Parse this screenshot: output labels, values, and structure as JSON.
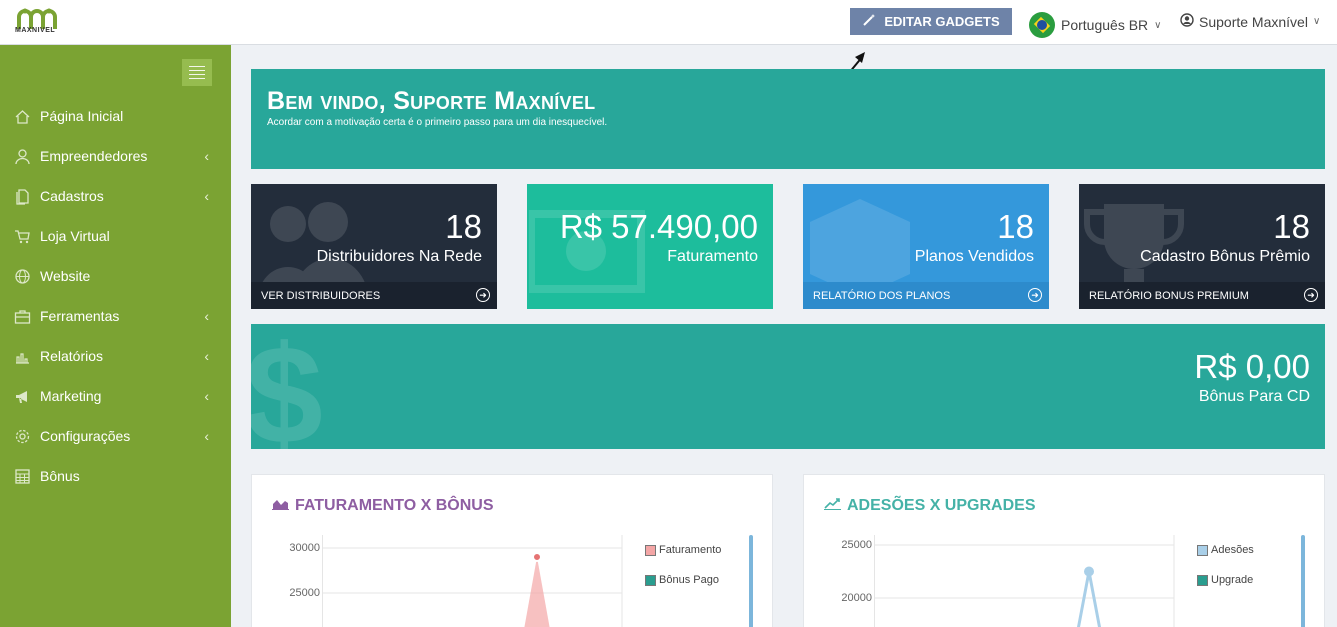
{
  "header": {
    "logo_text": "MAXNIVEL",
    "edit_gadgets_label": "EDITAR GADGETS",
    "language_label": "Português BR",
    "user_label": "Suporte Maxnível"
  },
  "sidebar": {
    "items": [
      {
        "label": "Página Inicial",
        "icon": "home-icon",
        "has_submenu": false
      },
      {
        "label": "Empreendedores",
        "icon": "user-icon",
        "has_submenu": true
      },
      {
        "label": "Cadastros",
        "icon": "files-icon",
        "has_submenu": true
      },
      {
        "label": "Loja Virtual",
        "icon": "cart-icon",
        "has_submenu": false
      },
      {
        "label": "Website",
        "icon": "globe-icon",
        "has_submenu": false
      },
      {
        "label": "Ferramentas",
        "icon": "toolbox-icon",
        "has_submenu": true
      },
      {
        "label": "Relatórios",
        "icon": "bar-chart-icon",
        "has_submenu": true
      },
      {
        "label": "Marketing",
        "icon": "megaphone-icon",
        "has_submenu": true
      },
      {
        "label": "Configurações",
        "icon": "gear-icon",
        "has_submenu": true
      },
      {
        "label": "Bônus",
        "icon": "calculator-icon",
        "has_submenu": false
      }
    ]
  },
  "welcome": {
    "title": "Bem vindo, Suporte Maxnível",
    "subtitle": "Acordar com a motivação certa é o primeiro passo para um dia inesquecível."
  },
  "tiles": [
    {
      "value": "18",
      "label": "Distribuidores Na Rede",
      "footer": "VER DISTRIBUIDORES",
      "icon": "users-icon",
      "color": "#232d3b"
    },
    {
      "value": "R$ 57.490,00",
      "label": "Faturamento",
      "footer": "",
      "icon": "money-icon",
      "color": "#1dbd9c"
    },
    {
      "value": "18",
      "label": "Planos Vendidos",
      "footer": "RELATÓRIO DOS PLANOS",
      "icon": "box-icon",
      "color": "#3498db"
    },
    {
      "value": "18",
      "label": "Cadastro Bônus Prêmio",
      "footer": "RELATÓRIO BONUS PREMIUM",
      "icon": "trophy-icon",
      "color": "#232d3b"
    }
  ],
  "bonus_cd": {
    "value": "R$ 0,00",
    "label": "Bônus Para CD",
    "icon": "dollar-icon"
  },
  "chart_data": [
    {
      "type": "area",
      "title": "FATURAMENTO X BÔNUS",
      "yticks": [
        "30000",
        "25000"
      ],
      "series": [
        {
          "name": "Faturamento",
          "color": "#f4a6a6"
        },
        {
          "name": "Bônus Pago",
          "color": "#2a9d8f"
        }
      ],
      "peak_value": 29000,
      "ylim_visible": [
        22000,
        30000
      ]
    },
    {
      "type": "line",
      "title": "ADESÕES X UPGRADES",
      "yticks": [
        "25000",
        "20000"
      ],
      "series": [
        {
          "name": "Adesões",
          "color": "#a9cfe8"
        },
        {
          "name": "Upgrade",
          "color": "#2a9d8f"
        }
      ],
      "peak_value": 22500,
      "ylim_visible": [
        16000,
        25000
      ]
    }
  ],
  "colors": {
    "sidebar": "#7ba333",
    "accent_teal": "#28a79a",
    "button": "#6e83a8"
  }
}
